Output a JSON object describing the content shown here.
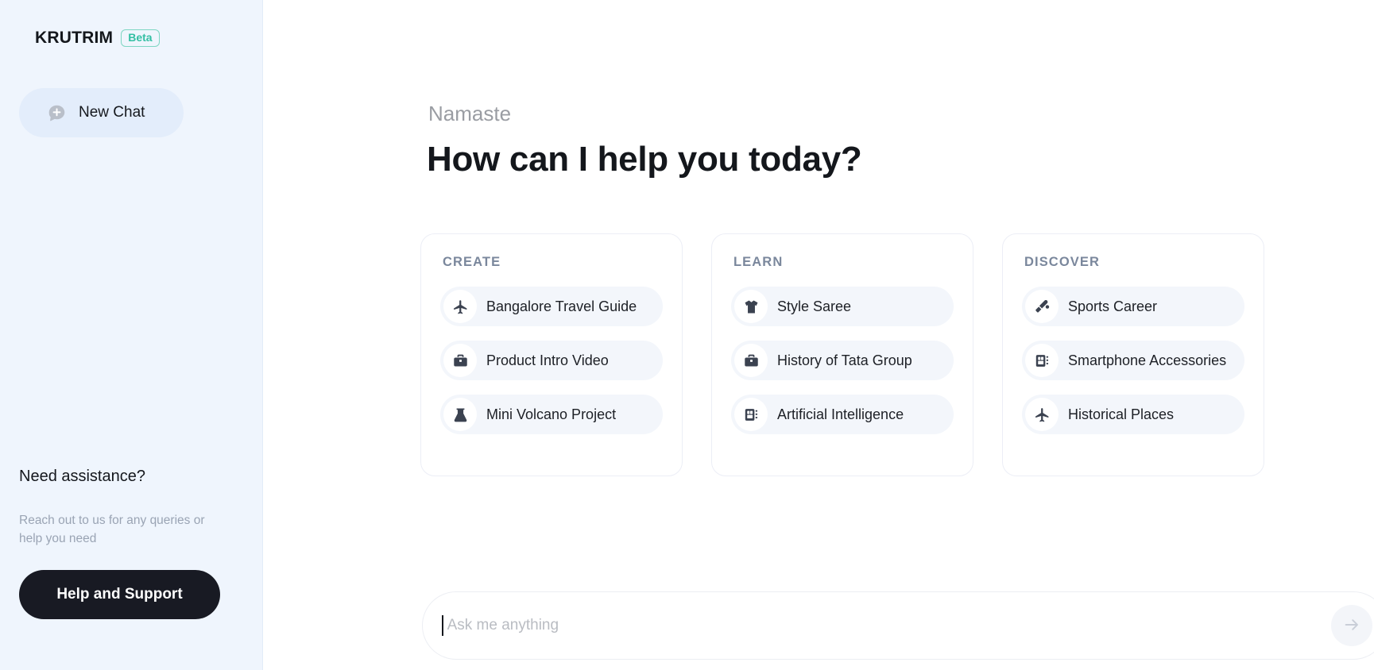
{
  "sidebar": {
    "brand_name": "KRUTRIM",
    "beta_badge": "Beta",
    "new_chat_label": "New Chat",
    "new_chat_icon": "chat-plus-icon",
    "assistance": {
      "title": "Need assistance?",
      "subtitle": "Reach out to us for any queries or help you need",
      "help_button_label": "Help and Support"
    }
  },
  "main": {
    "greeting": "Namaste",
    "headline": "How can I help you today?",
    "cards": [
      {
        "title": "CREATE",
        "items": [
          {
            "label": "Bangalore Travel Guide",
            "icon": "airplane-icon"
          },
          {
            "label": "Product Intro Video",
            "icon": "briefcase-icon"
          },
          {
            "label": "Mini Volcano Project",
            "icon": "flask-icon"
          }
        ]
      },
      {
        "title": "LEARN",
        "items": [
          {
            "label": "Style Saree",
            "icon": "tshirt-icon"
          },
          {
            "label": "History of Tata Group",
            "icon": "briefcase-icon"
          },
          {
            "label": "Artificial Intelligence",
            "icon": "chip-icon"
          }
        ]
      },
      {
        "title": "DISCOVER",
        "items": [
          {
            "label": "Sports Career",
            "icon": "cricket-bat-icon"
          },
          {
            "label": "Smartphone Accessories",
            "icon": "chip-icon"
          },
          {
            "label": "Historical Places",
            "icon": "airplane-icon"
          }
        ]
      }
    ],
    "composer": {
      "value": "",
      "placeholder": "Ask me anything",
      "send_icon": "arrow-right-icon"
    }
  },
  "colors": {
    "sidebar_bg": "#eff5fd",
    "beta_accent": "#33bfa3",
    "card_title": "#7a879c",
    "pill_bg": "#f3f6fb",
    "help_button_bg": "#181a23"
  }
}
